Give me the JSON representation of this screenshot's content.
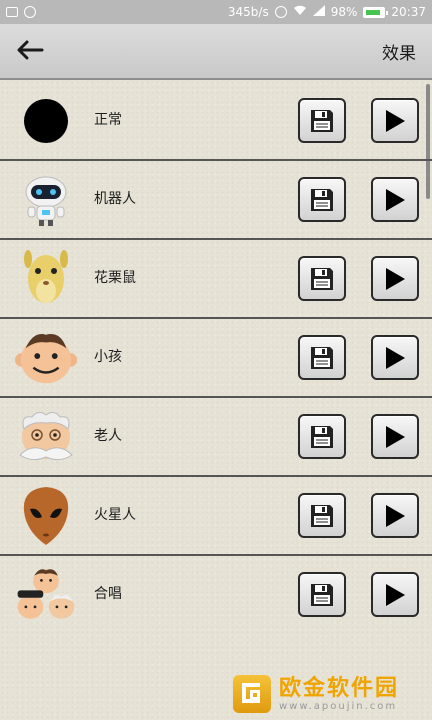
{
  "status_bar": {
    "net_speed": "345b/s",
    "battery": "98%",
    "time": "20:37"
  },
  "toolbar": {
    "title": "效果"
  },
  "effects": [
    {
      "label": "正常",
      "avatar": "black-circle"
    },
    {
      "label": "机器人",
      "avatar": "robot"
    },
    {
      "label": "花栗鼠",
      "avatar": "chipmunk"
    },
    {
      "label": "小孩",
      "avatar": "child"
    },
    {
      "label": "老人",
      "avatar": "old-man"
    },
    {
      "label": "火星人",
      "avatar": "alien"
    },
    {
      "label": "合唱",
      "avatar": "chorus"
    }
  ],
  "watermark": {
    "main": "欧金软件园",
    "sub": "www.apoujin.com"
  },
  "icons": {
    "back": "arrow-left-icon",
    "save": "floppy-disk-icon",
    "play": "play-icon"
  }
}
